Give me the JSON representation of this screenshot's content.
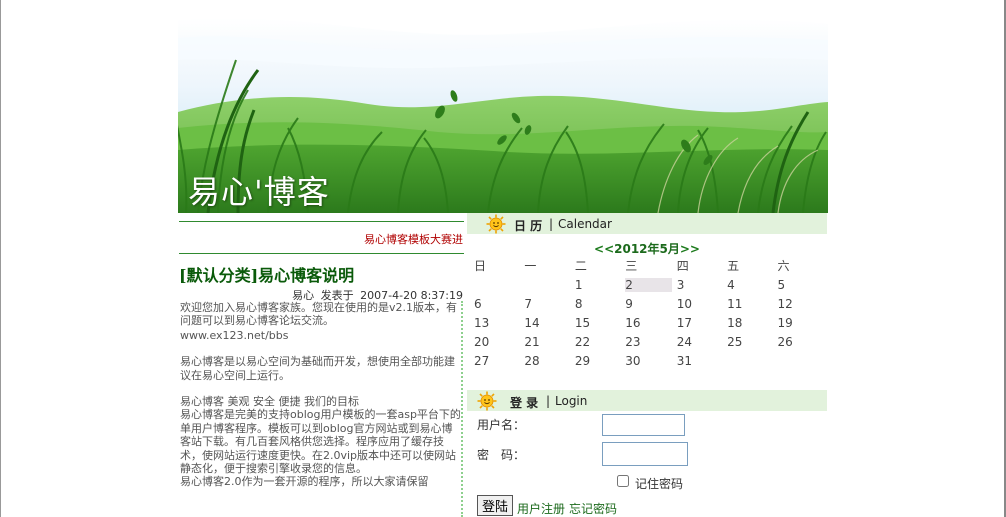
{
  "site": {
    "title": "易心'博客"
  },
  "left": {
    "contest_link": "易心博客模板大赛进",
    "post": {
      "title": "[默认分类]易心博客说明",
      "author": "易心",
      "posted_label": "发表于",
      "datetime": "2007-4-20 8:37:19",
      "paragraphs": [
        "欢迎您加入易心博客家族。您现在使用的是v2.1版本，有问题可以到易心博客论坛交流。",
        "www.ex123.net/bbs",
        "易心博客是以易心空间为基础而开发，想使用全部功能建议在易心空间上运行。",
        "易心博客 美观 安全 便捷 我们的目标",
        "易心博客是完美的支持oblog用户模板的一套asp平台下的单用户博客程序。模板可以到oblog官方网站或到易心博客站下载。有几百套风格供您选择。程序应用了缓存技术，使网站运行速度更快。在2.0vip版本中还可以使网站静态化，便于搜索引擎收录您的信息。",
        "易心博客2.0作为一套开源的程序，所以大家请保留"
      ]
    }
  },
  "calendar": {
    "heading": "日 历",
    "heading_en": "Calendar",
    "separator": "|",
    "prev": "<<",
    "next": ">>",
    "month_label": "2012年5月",
    "weekdays": [
      "日",
      "一",
      "二",
      "三",
      "四",
      "五",
      "六"
    ],
    "weeks": [
      [
        "",
        "",
        "1",
        "2",
        "3",
        "4",
        "5"
      ],
      [
        "6",
        "7",
        "8",
        "9",
        "10",
        "11",
        "12"
      ],
      [
        "13",
        "14",
        "15",
        "16",
        "17",
        "18",
        "19"
      ],
      [
        "20",
        "21",
        "22",
        "23",
        "24",
        "25",
        "26"
      ],
      [
        "27",
        "28",
        "29",
        "30",
        "31",
        "",
        ""
      ]
    ],
    "highlighted_day": "2"
  },
  "login": {
    "heading": "登 录",
    "heading_en": "Login",
    "separator": "|",
    "username_label": "用户名：",
    "username_value": "",
    "password_label": "密　码：",
    "password_value": "",
    "remember_label": "记住密码",
    "remember_checked": false,
    "submit_label": "登陆",
    "register_link": "用户注册",
    "forgot_link": "忘记密码"
  },
  "colors": {
    "accent_green": "#1c6a1c",
    "title_green": "#0a5a0a",
    "link_red": "#b00000",
    "panel_bg": "#e2f2dc"
  },
  "icons": {
    "panel_icon": "smiling-sun-icon"
  }
}
